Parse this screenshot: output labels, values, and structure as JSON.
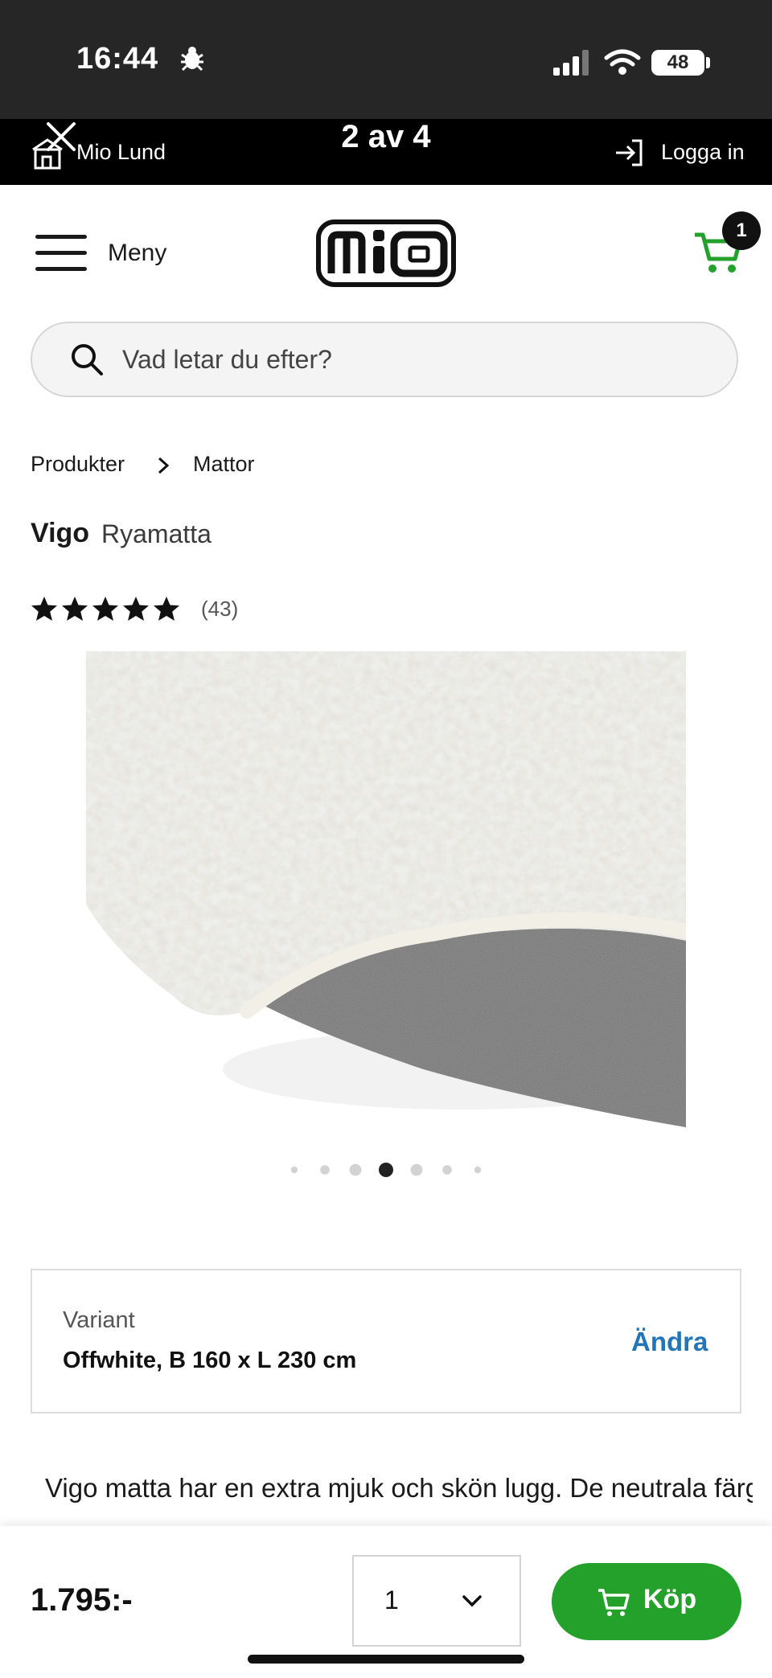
{
  "status_bar": {
    "time": "16:44",
    "battery": "48"
  },
  "top_bar": {
    "store": "Mio Lund",
    "pager": "2 av 4",
    "login": "Logga in"
  },
  "header": {
    "menu_label": "Meny",
    "logo": "mio",
    "cart_count": "1"
  },
  "search": {
    "placeholder": "Vad letar du efter?"
  },
  "breadcrumb": [
    "Produkter",
    "Mattor"
  ],
  "product": {
    "brand": "Vigo",
    "type": "Ryamatta",
    "rating": 5,
    "review_count": "(43)",
    "image_count": 7,
    "active_image_index": 3
  },
  "variant": {
    "label": "Variant",
    "value": "Offwhite, B 160 x L 230 cm",
    "change": "Ändra"
  },
  "description": "Vigo matta har en extra mjuk och skön lugg. De neutrala färgerna gör att den passar i hemmets alla rum.",
  "purchase": {
    "price": "1.795:-",
    "quantity": "1",
    "buy_label": "Köp"
  },
  "colors": {
    "brand_green": "#23a12a",
    "link_blue": "#2276b8"
  }
}
